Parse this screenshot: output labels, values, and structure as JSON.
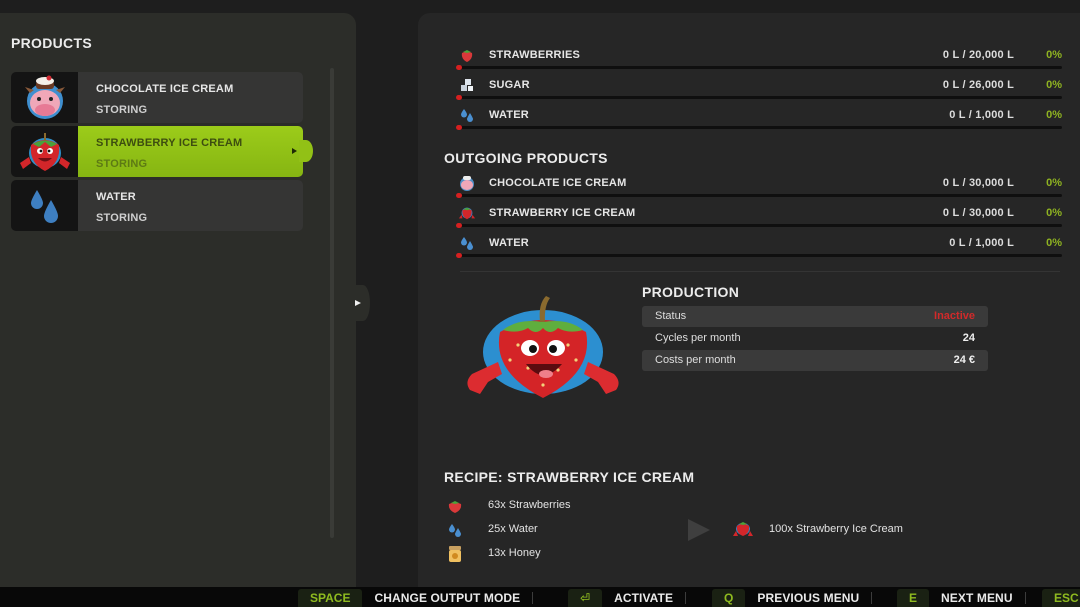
{
  "left": {
    "title": "PRODUCTS",
    "products": [
      {
        "name": "CHOCOLATE ICE CREAM",
        "status": "STORING",
        "icon": "cow-ice-cream-icon"
      },
      {
        "name": "STRAWBERRY ICE CREAM",
        "status": "STORING",
        "icon": "strawberry-mascot-icon",
        "selected": true
      },
      {
        "name": "WATER",
        "status": "STORING",
        "icon": "water-drops-icon"
      }
    ]
  },
  "incoming": {
    "items": [
      {
        "name": "STRAWBERRIES",
        "amount": "0 L / 20,000 L",
        "percent": "0%",
        "fill": 0,
        "icon": "strawberry-icon"
      },
      {
        "name": "SUGAR",
        "amount": "0 L / 26,000 L",
        "percent": "0%",
        "fill": 0,
        "icon": "sugar-cubes-icon"
      },
      {
        "name": "WATER",
        "amount": "0 L / 1,000 L",
        "percent": "0%",
        "fill": 0,
        "icon": "water-drops-icon"
      }
    ]
  },
  "outgoing": {
    "title": "OUTGOING PRODUCTS",
    "items": [
      {
        "name": "CHOCOLATE ICE CREAM",
        "amount": "0 L / 30,000 L",
        "percent": "0%",
        "fill": 0,
        "icon": "cow-ice-cream-icon"
      },
      {
        "name": "STRAWBERRY ICE CREAM",
        "amount": "0 L / 30,000 L",
        "percent": "0%",
        "fill": 0,
        "icon": "strawberry-mascot-icon"
      },
      {
        "name": "WATER",
        "amount": "0 L / 1,000 L",
        "percent": "0%",
        "fill": 0,
        "icon": "water-drops-icon"
      }
    ]
  },
  "production": {
    "title": "PRODUCTION",
    "rows": [
      {
        "label": "Status",
        "value": "Inactive"
      },
      {
        "label": "Cycles per month",
        "value": "24"
      },
      {
        "label": "Costs per month",
        "value": "24 €"
      }
    ]
  },
  "recipe": {
    "title": "RECIPE: STRAWBERRY ICE CREAM",
    "inputs": [
      {
        "text": "63x Strawberries",
        "icon": "strawberry-icon"
      },
      {
        "text": "25x Water",
        "icon": "water-drops-icon"
      },
      {
        "text": "13x Honey",
        "icon": "honey-jar-icon"
      }
    ],
    "output": {
      "text": "100x Strawberry Ice Cream",
      "icon": "strawberry-mascot-icon"
    }
  },
  "bottom_bar": {
    "actions": [
      {
        "key": "SPACE",
        "label": "CHANGE OUTPUT MODE"
      },
      {
        "key": "⏎",
        "label": "ACTIVATE"
      },
      {
        "key": "Q",
        "label": "PREVIOUS MENU"
      },
      {
        "key": "E",
        "label": "NEXT MENU"
      },
      {
        "key": "ESC",
        "label": ""
      }
    ]
  },
  "colors": {
    "accent": "#92c116",
    "inactive": "#d12a2a",
    "percent": "#8fb321",
    "fill_bar": "#d62020"
  }
}
